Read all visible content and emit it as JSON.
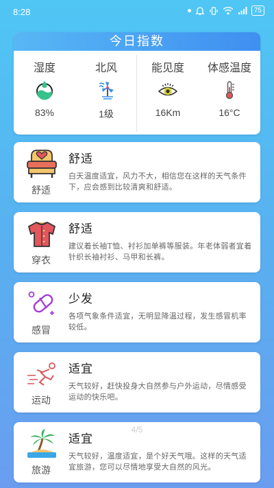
{
  "status_bar": {
    "time": "8:28",
    "battery": "75"
  },
  "index_card": {
    "title": "今日指数",
    "items": [
      {
        "label": "湿度",
        "value": "83%"
      },
      {
        "label": "北风",
        "value": "1级"
      },
      {
        "label": "能见度",
        "value": "16Km"
      },
      {
        "label": "体感温度",
        "value": "16°C"
      }
    ]
  },
  "life_items": [
    {
      "icon_label": "舒适",
      "title": "舒适",
      "desc": "白天温度适宜，风力不大，相信您在这样的天气条件下，应会感到比较清爽和舒适。"
    },
    {
      "icon_label": "穿衣",
      "title": "舒适",
      "desc": "建议着长袖T恤、衬衫加单裤等服装。年老体弱者宜着针织长袖衬衫、马甲和长裤。"
    },
    {
      "icon_label": "感冒",
      "title": "少发",
      "desc": "各项气象条件适宜，无明显降温过程，发生感冒机率较低。"
    },
    {
      "icon_label": "运动",
      "title": "适宜",
      "desc": "天气较好，赶快投身大自然参与户外运动，尽情感受运动的快乐吧。"
    },
    {
      "icon_label": "旅游",
      "title": "适宜",
      "desc": "天气较好，温度适宜，是个好天气哦。这样的天气适宜旅游，您可以尽情地享受大自然的风光。"
    }
  ],
  "page_indicator": "4/5"
}
